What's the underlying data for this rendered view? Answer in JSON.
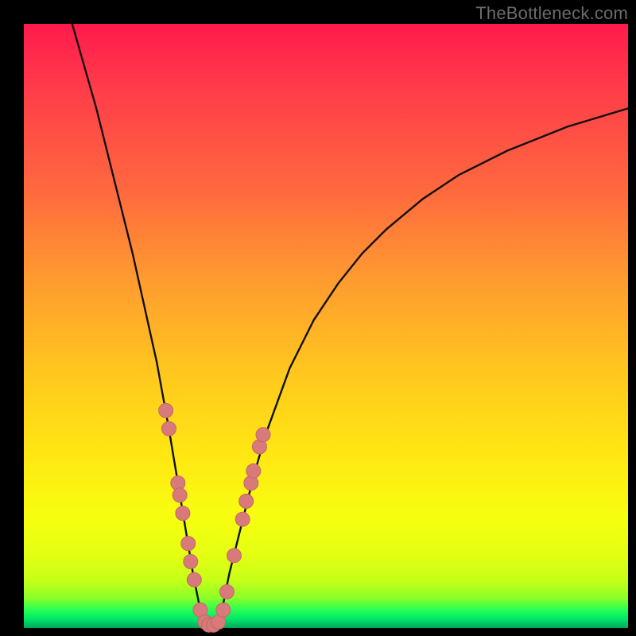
{
  "watermark": "TheBottleneck.com",
  "colors": {
    "curve_stroke": "#101010",
    "marker_fill": "#d97a7a",
    "marker_stroke": "#c46767",
    "frame_bg": "#000000"
  },
  "chart_data": {
    "type": "line",
    "title": "",
    "xlabel": "",
    "ylabel": "",
    "xlim": [
      0,
      100
    ],
    "ylim": [
      0,
      100
    ],
    "grid": false,
    "legend": false,
    "series": [
      {
        "name": "bottleneck-curve",
        "x": [
          8,
          10,
          12,
          14,
          16,
          18,
          20,
          22,
          24,
          25,
          26,
          27,
          28,
          29,
          30,
          31,
          32,
          33,
          34,
          36,
          38,
          40,
          44,
          48,
          52,
          56,
          60,
          66,
          72,
          80,
          90,
          100
        ],
        "y": [
          100,
          93,
          86,
          78,
          70,
          62,
          53,
          44,
          33,
          27,
          21,
          15,
          9,
          4,
          1,
          0,
          1,
          4,
          9,
          17,
          25,
          32,
          43,
          51,
          57,
          62,
          66,
          71,
          75,
          79,
          83,
          86
        ]
      }
    ],
    "markers": [
      {
        "x": 23.5,
        "y": 36
      },
      {
        "x": 24.0,
        "y": 33
      },
      {
        "x": 25.5,
        "y": 24
      },
      {
        "x": 25.8,
        "y": 22
      },
      {
        "x": 26.3,
        "y": 19
      },
      {
        "x": 27.2,
        "y": 14
      },
      {
        "x": 27.6,
        "y": 11
      },
      {
        "x": 28.2,
        "y": 8
      },
      {
        "x": 29.2,
        "y": 3
      },
      {
        "x": 30.0,
        "y": 1
      },
      {
        "x": 30.6,
        "y": 0.5
      },
      {
        "x": 31.4,
        "y": 0.5
      },
      {
        "x": 32.2,
        "y": 1
      },
      {
        "x": 33.0,
        "y": 3
      },
      {
        "x": 33.6,
        "y": 6
      },
      {
        "x": 34.8,
        "y": 12
      },
      {
        "x": 36.2,
        "y": 18
      },
      {
        "x": 36.8,
        "y": 21
      },
      {
        "x": 37.6,
        "y": 24
      },
      {
        "x": 38.0,
        "y": 26
      },
      {
        "x": 39.0,
        "y": 30
      },
      {
        "x": 39.6,
        "y": 32
      }
    ]
  }
}
